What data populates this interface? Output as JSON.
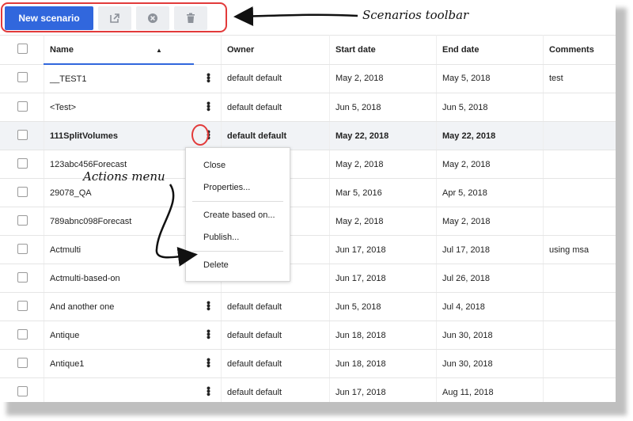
{
  "toolbar": {
    "new_scenario_label": "New scenario",
    "icons": [
      "export-icon",
      "close-circle-icon",
      "trash-icon"
    ]
  },
  "annotations": {
    "toolbar_label": "Scenarios toolbar",
    "actions_label": "Actions menu"
  },
  "table": {
    "columns": [
      "Name",
      "Owner",
      "Start date",
      "End date",
      "Comments"
    ],
    "sort_indicator": "▲",
    "rows": [
      {
        "name": "__TEST1",
        "owner": "default default",
        "start": "May 2, 2018",
        "end": "May 5, 2018",
        "comments": "test"
      },
      {
        "name": "<Test>",
        "owner": "default default",
        "start": "Jun 5, 2018",
        "end": "Jun 5, 2018",
        "comments": ""
      },
      {
        "name": "111SplitVolumes",
        "owner": "default default",
        "start": "May 22, 2018",
        "end": "May 22, 2018",
        "comments": ""
      },
      {
        "name": "123abc456Forecast",
        "owner": "",
        "start": "May 2, 2018",
        "end": "May 2, 2018",
        "comments": ""
      },
      {
        "name": "29078_QA",
        "owner": "",
        "start": "Mar 5, 2016",
        "end": "Apr 5, 2018",
        "comments": ""
      },
      {
        "name": "789abnc098Forecast",
        "owner": "",
        "start": "May 2, 2018",
        "end": "May 2, 2018",
        "comments": ""
      },
      {
        "name": "Actmulti",
        "owner": "",
        "start": "Jun 17, 2018",
        "end": "Jul 17, 2018",
        "comments": "using msa"
      },
      {
        "name": "Actmulti-based-on",
        "owner": "",
        "start": "Jun 17, 2018",
        "end": "Jul 26, 2018",
        "comments": ""
      },
      {
        "name": "And another one",
        "owner": "default default",
        "start": "Jun 5, 2018",
        "end": "Jul 4, 2018",
        "comments": ""
      },
      {
        "name": "Antique",
        "owner": "default default",
        "start": "Jun 18, 2018",
        "end": "Jun 30, 2018",
        "comments": ""
      },
      {
        "name": "Antique1",
        "owner": "default default",
        "start": "Jun 18, 2018",
        "end": "Jun 30, 2018",
        "comments": ""
      },
      {
        "name": "",
        "owner": "default default",
        "start": "Jun 17, 2018",
        "end": "Aug 11, 2018",
        "comments": ""
      }
    ]
  },
  "menu": {
    "items": [
      "Close",
      "Properties...",
      "Create based on...",
      "Publish...",
      "Delete"
    ]
  },
  "colors": {
    "accent": "#3167dd",
    "highlight": "#e23a3a"
  }
}
